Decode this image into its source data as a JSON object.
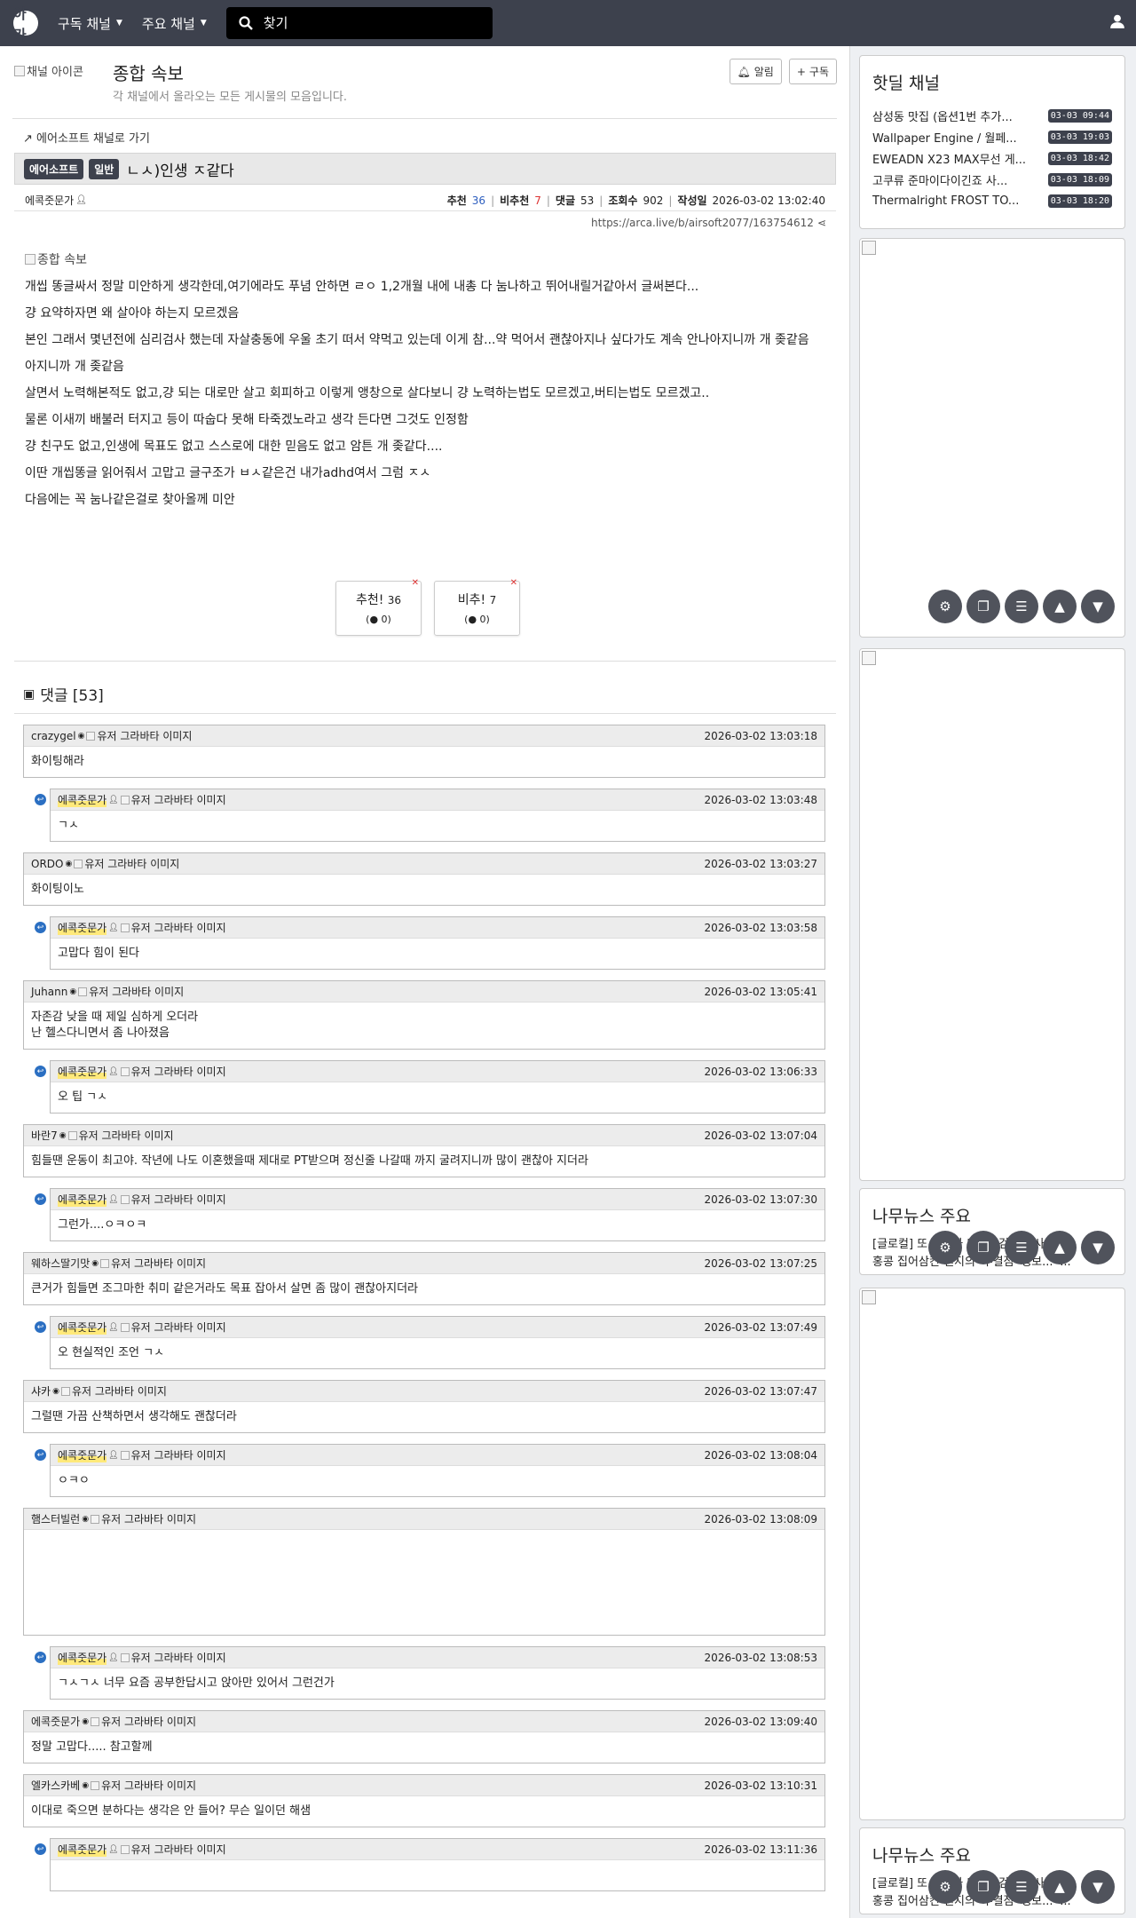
{
  "nav": {
    "logo": "아카",
    "subscribed": "구독 채널",
    "major": "주요 채널",
    "search_placeholder": "찾기"
  },
  "channel": {
    "icon_alt": "채널 아이콘",
    "title": "종합 속보",
    "desc": "각 채널에서 올라오는 모든 게시물의 모음입니다.",
    "alarm": "알림",
    "subscribe": "구독"
  },
  "post": {
    "back_link": "에어소프트 채널로 가기",
    "badge1": "에어소프트",
    "badge2": "일반",
    "title": "ㄴㅅ)인생 ㅈ같다",
    "author": "에콕줏문가",
    "rec_label": "추천",
    "rec": "36",
    "unrec_label": "비추천",
    "unrec": "7",
    "comments_label": "댓글",
    "comments": "53",
    "views_label": "조회수",
    "views": "902",
    "date_label": "작성일",
    "date": "2026-03-02 13:02:40",
    "url": "https://arca.live/b/airsoft2077/163754612",
    "image_alt": "종합 속보",
    "lines": [
      "개씹 똥글싸서 정말 미안하게 생각한데,여기에라도 푸념 안하면 ㄹㅇ 1,2개월 내에 내총 다 눔나하고 뛰어내릴거같아서 글써본다...",
      "걍 요약하자면 왜 살아야 하는지 모르겠음",
      "본인 그래서 몇년전에 심리검사 했는데 자살충동에 우울 초기 떠서 약먹고 있는데 이게 참...약 먹어서 괜찮아지나 싶다가도 계속 안나아지니까 개 좆같음",
      "아지니까 개 좆같음",
      "살면서 노력해본적도 없고,걍 되는 대로만 살고 회피하고 이렇게 앵창으로 살다보니 걍 노력하는법도 모르겠고,버티는법도 모르겠고..",
      "물론 이새끼 배불러 터지고 등이 따숩다 못해 타죽겠노라고 생각 든다면 그것도 인정함",
      "걍 친구도 없고,인생에 목표도 없고 스스로에 대한 믿음도 없고 암튼 개 좆같다....",
      "이딴 개씹똥글 읽어줘서 고맙고 글구조가 ㅂㅅ같은건 내가adhd여서 그럼 ㅈㅅ",
      "다음에는 꼭 눔나같은걸로 찾아올께 미안"
    ],
    "vote_up": "추천!",
    "vote_up_n": "36",
    "vote_up_sub": "0",
    "vote_down": "비추!",
    "vote_down_n": "7",
    "vote_down_sub": "0"
  },
  "comment_head": "댓글 [53]",
  "avatar_alt": "유저 그라바타 이미지",
  "comments": [
    {
      "name": "crazygel",
      "reply": false,
      "time": "2026-03-02 13:03:18",
      "text": "화이팅해라"
    },
    {
      "name": "에콕줏문가",
      "reply": true,
      "time": "2026-03-02 13:03:48",
      "text": "ㄱㅅ"
    },
    {
      "name": "ORDO",
      "reply": false,
      "time": "2026-03-02 13:03:27",
      "text": "화이팅이노"
    },
    {
      "name": "에콕줏문가",
      "reply": true,
      "time": "2026-03-02 13:03:58",
      "text": "고맙다 힘이 된다"
    },
    {
      "name": "Juhann",
      "reply": false,
      "time": "2026-03-02 13:05:41",
      "text": "자존감 낮을 때 제일 심하게 오더라\n난 헬스다니면서 좀 나아졌음"
    },
    {
      "name": "에콕줏문가",
      "reply": true,
      "time": "2026-03-02 13:06:33",
      "text": "오 팁 ㄱㅅ"
    },
    {
      "name": "바란7",
      "reply": false,
      "time": "2026-03-02 13:07:04",
      "text": "힘들땐 운동이 최고야. 작년에 나도 이혼했을때 제대로 PT받으며 정신줄 나갈때 까지 굴려지니까 많이 괜찮아 지더라"
    },
    {
      "name": "에콕줏문가",
      "reply": true,
      "time": "2026-03-02 13:07:30",
      "text": "그런가....ㅇㅋㅇㅋ"
    },
    {
      "name": "웨하스딸기맛",
      "reply": false,
      "time": "2026-03-02 13:07:25",
      "text": "큰거가 힘들면 조그마한 취미 같은거라도 목표 잡아서 살면 좀 많이 괜찮아지더라"
    },
    {
      "name": "에콕줏문가",
      "reply": true,
      "time": "2026-03-02 13:07:49",
      "text": "오 현실적인 조언 ㄱㅅ"
    },
    {
      "name": "샤카",
      "reply": false,
      "time": "2026-03-02 13:07:47",
      "text": "그럴땐 가끔 산책하면서 생각해도 괜찮더라"
    },
    {
      "name": "에콕줏문가",
      "reply": true,
      "time": "2026-03-02 13:08:04",
      "text": "ㅇㅋㅇ"
    },
    {
      "name": "햄스터빌런",
      "reply": false,
      "time": "2026-03-02 13:08:09",
      "text": "",
      "big": true
    },
    {
      "name": "에콕줏문가",
      "reply": true,
      "time": "2026-03-02 13:08:53",
      "text": "ㄱㅅㄱㅅ 너무 요즘 공부한답시고 앉아만 있어서 그런건가"
    },
    {
      "name": "에콕줏문가",
      "reply": false,
      "time": "2026-03-02 13:09:40",
      "text": "정말 고맙다..... 참고할께"
    },
    {
      "name": "엘카스카베",
      "reply": false,
      "time": "2026-03-02 13:10:31",
      "text": "이대로 죽으면 분하다는 생각은 안 들어? 무슨 일이던 해샘"
    },
    {
      "name": "에콕줏문가",
      "reply": true,
      "time": "2026-03-02 13:11:36",
      "text": ""
    }
  ],
  "sidebar": {
    "hot_title": "핫딜 채널",
    "hot": [
      {
        "title": "삼성동 맛집 (옵션1번 추가...",
        "date": "03-03 09:44"
      },
      {
        "title": "Wallpaper Engine / 월페...",
        "date": "03-03 19:03"
      },
      {
        "title": "EWEADN X23 MAX무선 게...",
        "date": "03-03 18:42"
      },
      {
        "title": "고쿠류 준마이다이긴죠 사...",
        "date": "03-03 18:09"
      },
      {
        "title": "Thermalright FROST TO...",
        "date": "03-03 18:20"
      }
    ],
    "news_title": "나무뉴스 주요",
    "news1": "[글로컬] 또 옹주와 미 주 '검정 맹사'...",
    "news2": "홍콩 집어삼킨 젠지의 '무결점' 행보... '...",
    "news_title2": "나무뉴스 주요",
    "news3": "[글로컬] 또 옹주와 미 주 '검정 맹사'...",
    "news4": "홍콩 집어삼킨 젠지의 '무결점' 행보... '..."
  }
}
